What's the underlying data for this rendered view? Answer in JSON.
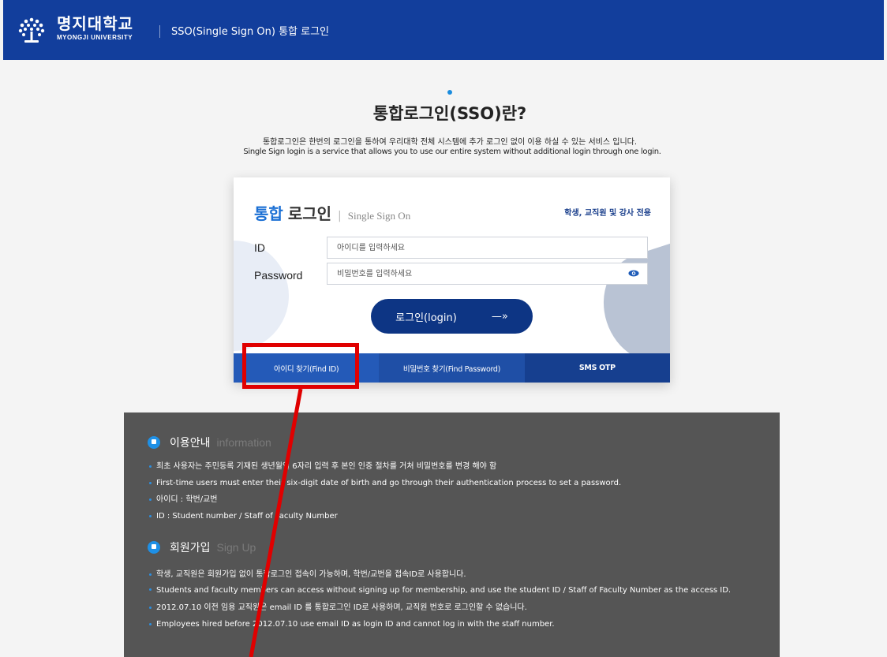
{
  "header": {
    "logo_ko": "명지대학교",
    "logo_en": "MYONGJI UNIVERSITY",
    "title": "SSO(Single Sign On) 통합 로그인",
    "bg_color": "#123e9c"
  },
  "intro": {
    "title": "통합로그인(SSO)란?",
    "desc_ko": "통합로그인은 한번의 로그인을 통하여 우리대학 전체 시스템에 추가 로그인 없이 이용 하실 수 있는 서비스 입니다.",
    "desc_en": "Single Sign login is a service that allows you to use our entire system without additional login through one login."
  },
  "login": {
    "title_accent": "통합",
    "title_rest": "로그인",
    "title_sep": "|",
    "title_en": "Single Sign On",
    "audience": "학생, 교직원 및 강사 전용",
    "id_label": "ID",
    "id_placeholder": "아이디를 입력하세요",
    "pw_label": "Password",
    "pw_placeholder": "비밀번호를 입력하세요",
    "button_label": "로그인(login)",
    "button_arrow": "—»",
    "accent_color": "#1a6fd4",
    "button_color": "#0d3584"
  },
  "tabs": [
    {
      "label": "아이디 찾기(Find ID)"
    },
    {
      "label": "비밀번호 찾기(Find Password)"
    },
    {
      "label": "SMS OTP"
    }
  ],
  "info": {
    "section1": {
      "title_ko": "이용안내",
      "title_en": "information",
      "items": [
        "최초 사용자는 주민등록 기재된 생년월일 6자리 입력 후 본인 인증 절차를 거쳐 비밀번호를 변경 해야 함",
        "First-time users must enter their six-digit date of birth and go through their authentication process to set a password.",
        "아이디 : 학번/교번",
        "ID : Student number / Staff of Faculty Number"
      ]
    },
    "section2": {
      "title_ko": "회원가입",
      "title_en": "Sign Up",
      "items": [
        "학생, 교직원은 회원가입 없이 통합로그인 접속이 가능하며, 학번/교번을 접속ID로 사용합니다.",
        "Students and faculty members can access without signing up for membership, and use the student ID / Staff of Faculty Number as the access ID.",
        "2012.07.10 이전 임용 교직원은 email ID 를 통합로그인 ID로 사용하며, 교직원 번호로 로그인할 수 없습니다.",
        "Employees hired before 2012.07.10 use email ID as login ID and cannot log in with the staff number."
      ]
    },
    "panel_color": "#555555",
    "bullet_color": "#2c8fe0"
  },
  "annotation": {
    "color": "#e00000"
  }
}
